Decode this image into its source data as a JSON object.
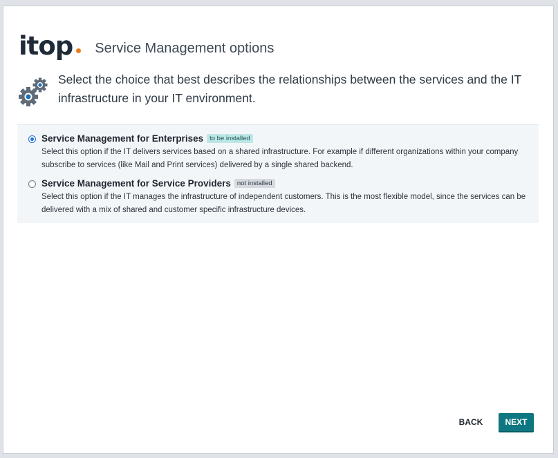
{
  "header": {
    "logo_text": "itop",
    "title": "Service Management options"
  },
  "intro": {
    "icon": "gears-icon",
    "text": "Select the choice that best describes the relationships between the services and the IT infrastructure in your IT environment."
  },
  "options": [
    {
      "title": "Service Management for Enterprises",
      "badge": "to be installed",
      "selected": true,
      "description": "Select this option if the IT delivers services based on a shared infrastructure. For example if different organizations within your company subscribe to services (like Mail and Print services) delivered by a single shared backend."
    },
    {
      "title": "Service Management for Service Providers",
      "badge": "not installed",
      "selected": false,
      "description": "Select this option if the IT manages the infrastructure of independent customers. This is the most flexible model, since the services can be delivered with a mix of shared and customer specific infrastructure devices."
    }
  ],
  "buttons": {
    "back": "BACK",
    "next": "NEXT"
  },
  "colors": {
    "accent": "#0e7782",
    "logo_orange": "#ea7d1e",
    "radio_blue": "#1f6fd6"
  }
}
